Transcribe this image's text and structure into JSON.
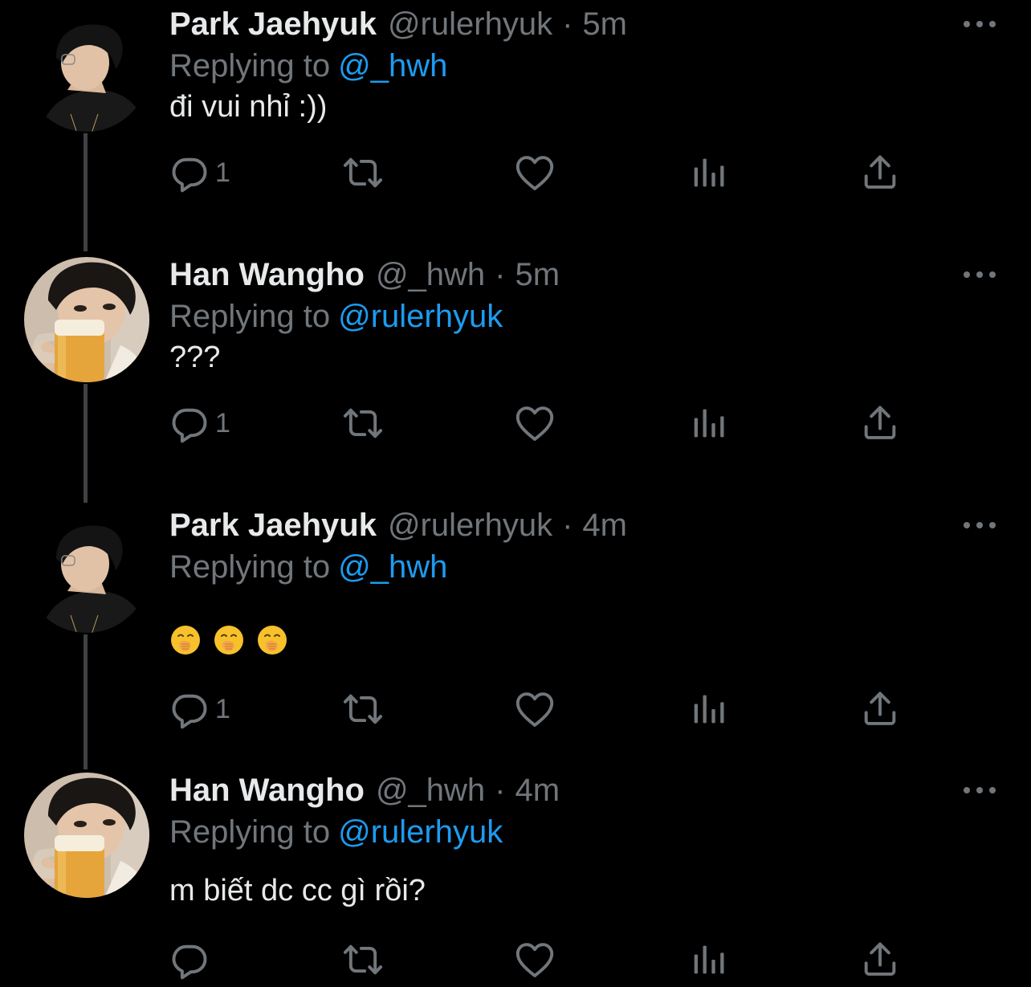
{
  "tweets": [
    {
      "name": "Park Jaehyuk",
      "handle": "@rulerhyuk",
      "separator": "·",
      "time": "5m",
      "replying_prefix": "Replying to",
      "replying_to": "@_hwh",
      "text": "đi vui nhỉ :))",
      "reply_count": "1",
      "avatar": "avatar-park"
    },
    {
      "name": "Han Wangho",
      "handle": "@_hwh",
      "separator": "·",
      "time": "5m",
      "replying_prefix": "Replying to",
      "replying_to": "@rulerhyuk",
      "text": "???",
      "reply_count": "1",
      "avatar": "avatar-han"
    },
    {
      "name": "Park Jaehyuk",
      "handle": "@rulerhyuk",
      "separator": "·",
      "time": "4m",
      "replying_prefix": "Replying to",
      "replying_to": "@_hwh",
      "text": "🤭🤭🤭",
      "reply_count": "1",
      "avatar": "avatar-park"
    },
    {
      "name": "Han Wangho",
      "handle": "@_hwh",
      "separator": "·",
      "time": "4m",
      "replying_prefix": "Replying to",
      "replying_to": "@rulerhyuk",
      "text": "m biết dc cc gì rồi?",
      "reply_count": "",
      "avatar": "avatar-han"
    }
  ],
  "icons": {
    "reply": "reply-icon",
    "retweet": "retweet-icon",
    "like": "heart-icon",
    "analytics": "analytics-icon",
    "share": "share-icon",
    "more": "more-icon"
  },
  "colors": {
    "background": "#000000",
    "primary_text": "#e7e9ea",
    "secondary_text": "#71767b",
    "mention": "#1d9bf0",
    "thread_line": "#3e4144"
  }
}
